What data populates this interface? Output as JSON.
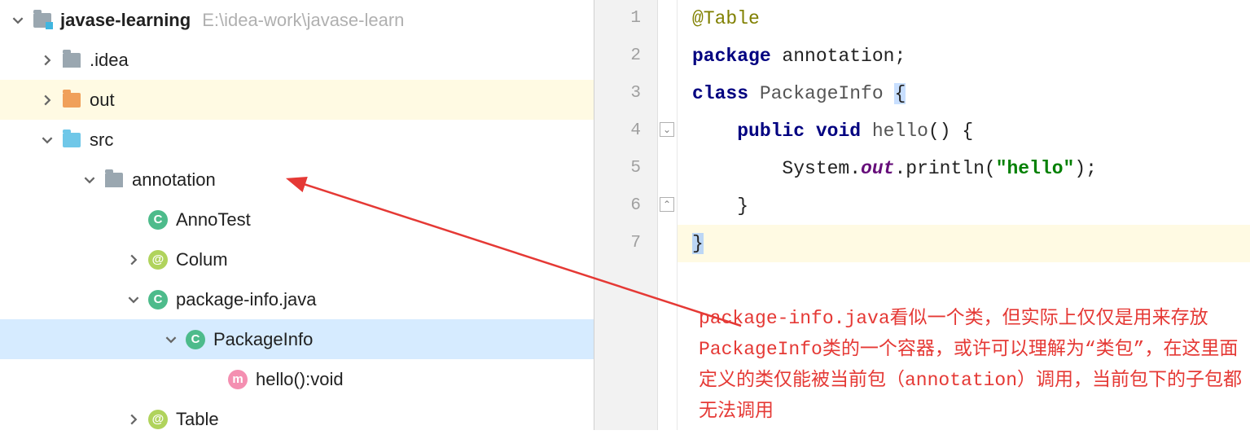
{
  "tree": {
    "root": {
      "name": "javase-learning",
      "path": "E:\\idea-work\\javase-learn"
    },
    "idea": ".idea",
    "out": "out",
    "src": "src",
    "annotation": "annotation",
    "annoTest": "AnnoTest",
    "colum": "Colum",
    "packageInfoJava": "package-info.java",
    "packageInfoClass": "PackageInfo",
    "helloMethod": "hello():void",
    "table": "Table"
  },
  "code": {
    "l1_ann": "@Table",
    "l2_kw": "package",
    "l2_pkg": " annotation",
    "l2_semi": ";",
    "l3_kw": "class",
    "l3_name": " PackageInfo ",
    "l3_brace": "{",
    "l4_indent": "    ",
    "l4_kw1": "public",
    "l4_sp": " ",
    "l4_kw2": "void",
    "l4_name": " hello",
    "l4_rest": "() {",
    "l5_indent": "        ",
    "l5_sys": "System.",
    "l5_out": "out",
    "l5_println": ".println(",
    "l5_str": "\"hello\"",
    "l5_close": ");",
    "l6_indent": "    ",
    "l6_brace": "}",
    "l7_brace": "}"
  },
  "gutter": [
    "1",
    "2",
    "3",
    "4",
    "5",
    "6",
    "7"
  ],
  "annotation": "package-info.java看似一个类，但实际上仅仅是用来存放PackageInfo类的一个容器，或许可以理解为“类包”，在这里面定义的类仅能被当前包（annotation）调用，当前包下的子包都无法调用"
}
